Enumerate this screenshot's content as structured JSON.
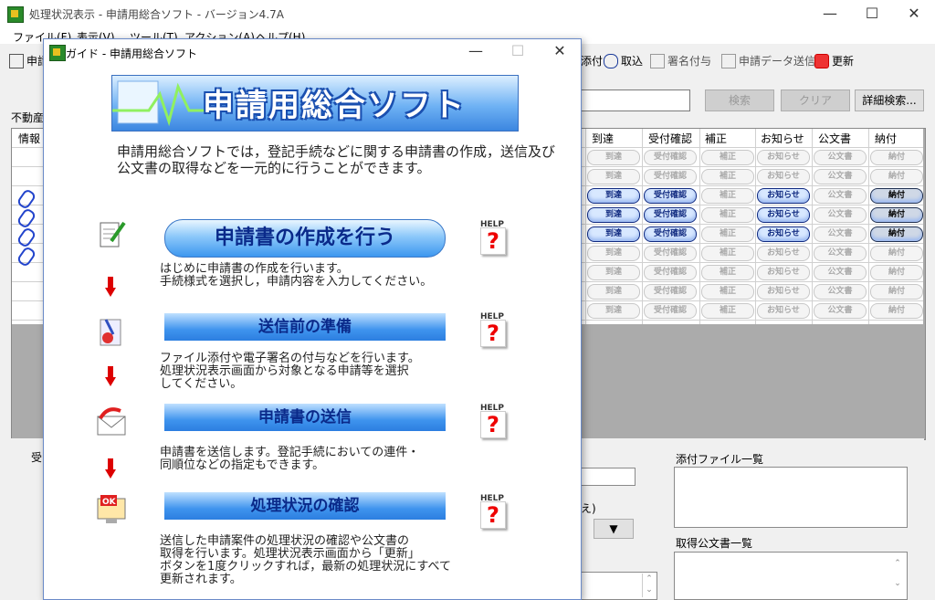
{
  "main_window": {
    "title": "処理状況表示 - 申請用総合ソフト - バージョン4.7A",
    "menu": [
      "ファイル(F)",
      "表示(V)",
      "ツール(T)",
      "アクション(A)",
      "ヘルプ(H)"
    ],
    "toolbar": [
      "申請",
      "添付",
      "取込",
      "署名付与",
      "申請データ送信",
      "更新"
    ],
    "search_button": "検索",
    "clear_button": "クリア",
    "detail_search_button": "詳細検索...",
    "tab": "不動産",
    "columns": [
      "情報",
      "到達",
      "受付確認",
      "補正",
      "お知らせ",
      "公文書",
      "納付"
    ],
    "pill_labels": {
      "arrival": "到達",
      "receipt": "受付確認",
      "correction": "補正",
      "notice": "お知らせ",
      "docs": "公文書",
      "payment": "納付"
    },
    "rows_active": [
      false,
      false,
      true,
      true,
      true,
      false,
      false,
      false,
      false
    ],
    "bottom": {
      "receipt_label": "受",
      "partial_text": "え)",
      "attachments_label": "添付ファイル一覧",
      "acquired_docs_label": "取得公文書一覧",
      "dropdown_glyph": "▼"
    }
  },
  "guide_dialog": {
    "title": "ガイド - 申請用総合ソフト",
    "banner": "申請用総合ソフト",
    "intro": "申請用総合ソフトでは，登記手続などに関する申請書の作成，送信及び公文書の取得などを一元的に行うことができます。",
    "help_label": "HELP",
    "help_glyph": "?",
    "steps": [
      {
        "label": "申請書の作成を行う",
        "desc": "はじめに申請書の作成を行います。\n手続様式を選択し，申請内容を入力してください。"
      },
      {
        "label": "送信前の準備",
        "desc": "ファイル添付や電子署名の付与などを行います。\n処理状況表示画面から対象となる申請等を選択\nしてください。"
      },
      {
        "label": "申請書の送信",
        "desc": "申請書を送信します。登記手続においての連件・\n同順位などの指定もできます。"
      },
      {
        "label": "処理状況の確認",
        "desc": "送信した申請案件の処理状況の確認や公文書の\n取得を行います。処理状況表示画面から「更新」\nボタンを1度クリックすれば，最新の処理状況にすべて\n更新されます。"
      }
    ]
  }
}
